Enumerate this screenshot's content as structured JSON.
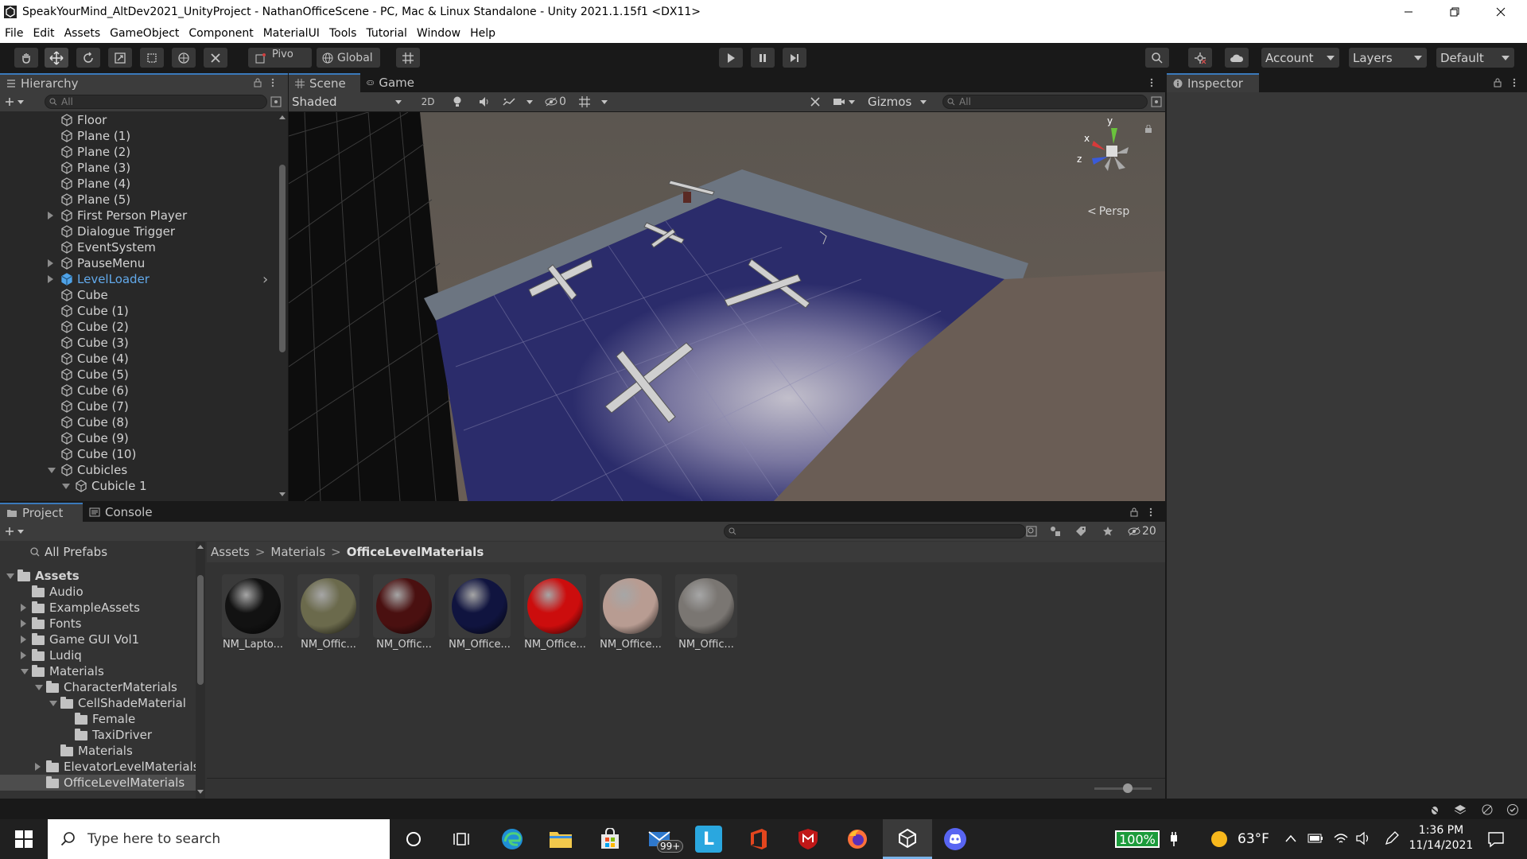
{
  "window": {
    "title": "SpeakYourMind_AltDev2021_UnityProject - NathanOfficeScene - PC, Mac & Linux Standalone - Unity 2021.1.15f1 <DX11>"
  },
  "menu": [
    "File",
    "Edit",
    "Assets",
    "GameObject",
    "Component",
    "MaterialUI",
    "Tools",
    "Tutorial",
    "Window",
    "Help"
  ],
  "toolbar": {
    "pivot_label": "Pivo",
    "global_label": "Global",
    "account_label": "Account",
    "layers_label": "Layers",
    "layout_label": "Default"
  },
  "hierarchy": {
    "tab_label": "Hierarchy",
    "search_placeholder": "All",
    "items": [
      {
        "label": "Floor"
      },
      {
        "label": "Plane (1)"
      },
      {
        "label": "Plane (2)"
      },
      {
        "label": "Plane (3)"
      },
      {
        "label": "Plane (4)"
      },
      {
        "label": "Plane (5)"
      },
      {
        "label": "First Person Player",
        "collapsed": true
      },
      {
        "label": "Dialogue Trigger"
      },
      {
        "label": "EventSystem"
      },
      {
        "label": "PauseMenu",
        "collapsed": true
      },
      {
        "label": "LevelLoader",
        "collapsed": true,
        "prefab": true
      },
      {
        "label": "Cube"
      },
      {
        "label": "Cube (1)"
      },
      {
        "label": "Cube (2)"
      },
      {
        "label": "Cube (3)"
      },
      {
        "label": "Cube (4)"
      },
      {
        "label": "Cube (5)"
      },
      {
        "label": "Cube (6)"
      },
      {
        "label": "Cube (7)"
      },
      {
        "label": "Cube (8)"
      },
      {
        "label": "Cube (9)"
      },
      {
        "label": "Cube (10)"
      },
      {
        "label": "Cubicles",
        "expanded": true
      },
      {
        "label": "Cubicle 1",
        "expanded": true,
        "indent": 1
      }
    ]
  },
  "scene": {
    "tab_scene": "Scene",
    "tab_game": "Game",
    "shading_mode": "Shaded",
    "mode_2d": "2D",
    "hidden_count": "0",
    "gizmos_label": "Gizmos",
    "search_placeholder": "All",
    "axis_x": "x",
    "axis_y": "y",
    "axis_z": "z",
    "projection_label": "Persp"
  },
  "inspector": {
    "tab_label": "Inspector"
  },
  "project": {
    "tab_project": "Project",
    "tab_console": "Console",
    "visible_count": "20",
    "all_prefabs": "All Prefabs",
    "breadcrumb": [
      "Assets",
      "Materials",
      "OfficeLevelMaterials"
    ],
    "tree": [
      {
        "label": "Assets",
        "bold": true
      },
      {
        "label": "Audio"
      },
      {
        "label": "ExampleAssets"
      },
      {
        "label": "Fonts"
      },
      {
        "label": "Game GUI Vol1"
      },
      {
        "label": "Ludiq"
      },
      {
        "label": "Materials"
      },
      {
        "label": "CharacterMaterials"
      },
      {
        "label": "CellShadeMaterial"
      },
      {
        "label": "Female"
      },
      {
        "label": "TaxiDriver"
      },
      {
        "label": "Materials"
      },
      {
        "label": "ElevatorLevelMaterials"
      },
      {
        "label": "OfficeLevelMaterials",
        "selected": true
      }
    ],
    "materials": [
      {
        "label": "NM_Lapto...",
        "color": "#121212"
      },
      {
        "label": "NM_Offic...",
        "color": "#6b6a4c"
      },
      {
        "label": "NM_Offic...",
        "color": "#4a1010"
      },
      {
        "label": "NM_Office...",
        "color": "#10143f"
      },
      {
        "label": "NM_Office...",
        "color": "#cc0d0d"
      },
      {
        "label": "NM_Office...",
        "color": "#b89c92"
      },
      {
        "label": "NM_Offic...",
        "color": "#7a7672"
      }
    ]
  },
  "taskbar": {
    "search_placeholder": "Type here to search",
    "mail_badge": "99+",
    "battery": "100%",
    "temperature": "63°F",
    "time": "1:36 PM",
    "date": "11/14/2021"
  }
}
